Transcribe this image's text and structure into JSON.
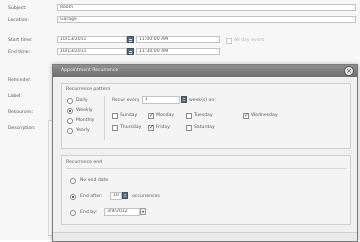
{
  "appointment": {
    "subject_label": "Subject:",
    "subject_value": "Room",
    "location_label": "Location:",
    "location_value": "Garage",
    "start_label": "Start time:",
    "start_date": "10/13/2011",
    "start_time": "11:00:00 AM",
    "end_label": "End time:",
    "end_date": "10/13/2011",
    "end_time": "11:30:00 AM",
    "all_day_label": "All day event",
    "reminder_label": "Reminder:",
    "label_label": "Label:",
    "resources_label": "Resources:",
    "description_label": "Description:"
  },
  "dialog": {
    "title": "Appointment Recurrence",
    "close_glyph": "×",
    "pattern": {
      "title": "Recurrence pattern",
      "options": [
        "Daily",
        "Weekly",
        "Monthly",
        "Yearly"
      ],
      "selected": "Weekly",
      "recur_every_label": "Recur every",
      "recur_every_value": "1",
      "weeks_on_label": "week(s) on:",
      "days": [
        {
          "label": "Sunday",
          "checked": false
        },
        {
          "label": "Monday",
          "checked": true
        },
        {
          "label": "Tuesday",
          "checked": false
        },
        {
          "label": "Wednesday",
          "checked": true
        },
        {
          "label": "Thursday",
          "checked": false
        },
        {
          "label": "Friday",
          "checked": true
        },
        {
          "label": "Saturday",
          "checked": false
        }
      ]
    },
    "range": {
      "title": "Recurrence end",
      "no_end_label": "No end date",
      "end_after_label": "End after:",
      "end_after_value": "10",
      "occurrences_label": "occurrences",
      "end_by_label": "End by:",
      "end_by_value": "3/9/2012",
      "selected": "end_after"
    }
  }
}
